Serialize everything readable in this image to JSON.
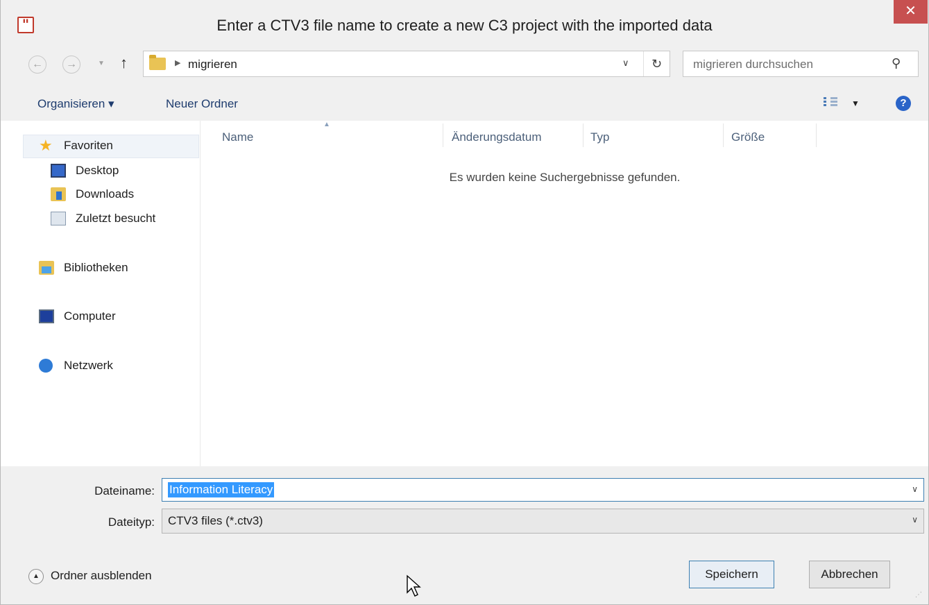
{
  "window": {
    "title": "Enter a CTV3 file name to create a new C3 project with the imported data",
    "app_icon": "quote-icon",
    "close_glyph": "✕"
  },
  "navigation": {
    "back_glyph": "←",
    "forward_glyph": "→",
    "up_glyph": "↑",
    "breadcrumb_folder": "migrieren",
    "search_placeholder": "migrieren durchsuchen"
  },
  "toolbar": {
    "organize_label": "Organisieren ▾",
    "new_folder_label": "Neuer Ordner",
    "help_glyph": "?"
  },
  "sidebar": {
    "groups": [
      {
        "label": "Favoriten",
        "icon": "star-icon"
      },
      {
        "label": "Desktop",
        "icon": "desktop-icon"
      },
      {
        "label": "Downloads",
        "icon": "downloads-folder-icon"
      },
      {
        "label": "Zuletzt besucht",
        "icon": "recent-places-icon"
      },
      {
        "label": "Bibliotheken",
        "icon": "libraries-icon"
      },
      {
        "label": "Computer",
        "icon": "computer-icon"
      },
      {
        "label": "Netzwerk",
        "icon": "network-icon"
      }
    ]
  },
  "file_list": {
    "columns": [
      "Name",
      "Änderungsdatum",
      "Typ",
      "Größe"
    ],
    "empty_message": "Es wurden keine Suchergebnisse gefunden."
  },
  "form": {
    "filename_label": "Dateiname:",
    "filename_value": "Information Literacy",
    "filetype_label": "Dateityp:",
    "filetype_value": "CTV3 files (*.ctv3)"
  },
  "footer": {
    "hide_folders_label": "Ordner ausblenden",
    "save_label": "Speichern",
    "cancel_label": "Abbrechen"
  },
  "colors": {
    "close_button": "#c75050",
    "selection": "#3399ff",
    "focus_border": "#3c7fb1"
  }
}
